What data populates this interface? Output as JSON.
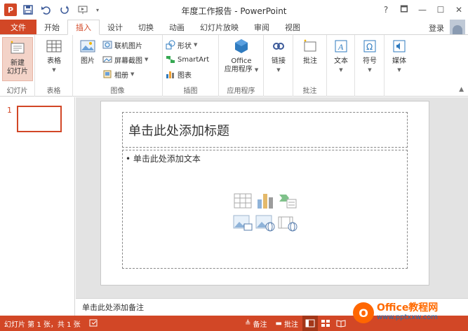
{
  "app": {
    "title": "年度工作报告 - PowerPoint",
    "icon_letter": "P"
  },
  "window": {
    "help": "?",
    "restore": "🗖",
    "minimize": "—",
    "maximize": "☐",
    "close": "✕"
  },
  "tabs": {
    "file": "文件",
    "items": [
      "开始",
      "插入",
      "设计",
      "切换",
      "动画",
      "幻灯片放映",
      "审阅",
      "视图"
    ],
    "active": "插入",
    "login": "登录"
  },
  "ribbon": {
    "slides": {
      "new_slide": "新建",
      "new_slide2": "幻灯片",
      "label": "幻灯片"
    },
    "tables": {
      "table": "表格",
      "label": "表格"
    },
    "images": {
      "picture": "图片",
      "online_pictures": "联机图片",
      "screenshot": "屏幕截图",
      "album": "相册",
      "label": "图像"
    },
    "illustrations": {
      "shapes": "形状",
      "smartart": "SmartArt",
      "chart": "图表",
      "label": "插图"
    },
    "apps": {
      "office": "Office",
      "apps_for_office": "应用程序",
      "label": "应用程序"
    },
    "links": {
      "link": "链接"
    },
    "comments": {
      "comment": "批注",
      "label": "批注"
    },
    "text": {
      "text": "文本"
    },
    "symbols": {
      "symbol": "符号"
    },
    "media": {
      "media": "媒体"
    },
    "accent": "#d24726"
  },
  "thumbnails": [
    {
      "number": "1"
    }
  ],
  "slide": {
    "title_placeholder": "单击此处添加标题",
    "body_placeholder": "• 单击此处添加文本"
  },
  "notes_placeholder": "单击此处添加备注",
  "status": {
    "slide_info": "幻灯片 第 1 张，共 1 张",
    "notes": "备注",
    "comments": "批注"
  },
  "watermark": {
    "logo": "O",
    "brand": "Office教程网",
    "url": "www.pptxxw.com"
  }
}
